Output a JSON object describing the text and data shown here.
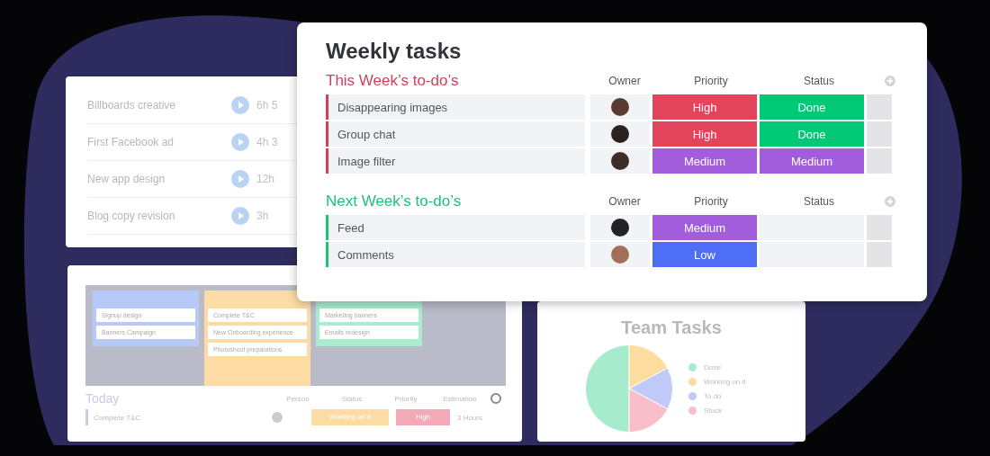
{
  "task_timer": {
    "rows": [
      {
        "name": "Billboards creative",
        "time": "6h 5"
      },
      {
        "name": "First Facebook ad",
        "time": "4h 3"
      },
      {
        "name": "New app design",
        "time": "12h"
      },
      {
        "name": "Blog copy revision",
        "time": "3h"
      }
    ]
  },
  "kanban": {
    "columns": [
      {
        "color": "#b6c9f7",
        "cards": [
          "Signup design",
          "Banners Campaign"
        ]
      },
      {
        "color": "#fcdca4",
        "cards": [
          "Complete T&C",
          "New Onboarding experience",
          "Photoshoot preparations"
        ]
      },
      {
        "color": "#a9ecd0",
        "cards": [
          "Marketing banners",
          "Emails redesign"
        ]
      }
    ],
    "today": {
      "title": "Today",
      "columns": [
        "Person",
        "Status",
        "Priority",
        "Estimation"
      ],
      "row": {
        "name": "Complete T&C",
        "status": {
          "label": "Working on it",
          "color": "#fcdca4"
        },
        "priority": {
          "label": "High",
          "color": "#f4a9b6"
        },
        "estimate": "3 Hours"
      }
    }
  },
  "team_tasks": {
    "title": "Team Tasks",
    "legend": [
      {
        "label": "Done",
        "color": "#a6ebcc"
      },
      {
        "label": "Working on it",
        "color": "#fddca0"
      },
      {
        "label": "To do",
        "color": "#c0c9f8"
      },
      {
        "label": "Stuck",
        "color": "#f8bfcb"
      }
    ]
  },
  "weekly": {
    "title": "Weekly tasks",
    "groups": [
      {
        "title": "This Week’s to-do’s",
        "color": "#d0415a",
        "columns": [
          "Owner",
          "Priority",
          "Status"
        ],
        "rows": [
          {
            "name": "Disappearing images",
            "priority": {
              "label": "High",
              "color": "#e2445c"
            },
            "status": {
              "label": "Done",
              "color": "#00c875"
            }
          },
          {
            "name": "Group chat",
            "priority": {
              "label": "High",
              "color": "#e2445c"
            },
            "status": {
              "label": "Done",
              "color": "#00c875"
            }
          },
          {
            "name": "Image filter",
            "priority": {
              "label": "Medium",
              "color": "#a25ddc"
            },
            "status": {
              "label": "Medium",
              "color": "#a25ddc"
            }
          }
        ]
      },
      {
        "title": "Next Week’s to-do’s",
        "color": "#1fc17b",
        "columns": [
          "Owner",
          "Priority",
          "Status"
        ],
        "rows": [
          {
            "name": "Feed",
            "priority": {
              "label": "Medium",
              "color": "#a25ddc"
            }
          },
          {
            "name": "Comments",
            "priority": {
              "label": "Low",
              "color": "#4d6ef5"
            }
          }
        ]
      }
    ]
  }
}
